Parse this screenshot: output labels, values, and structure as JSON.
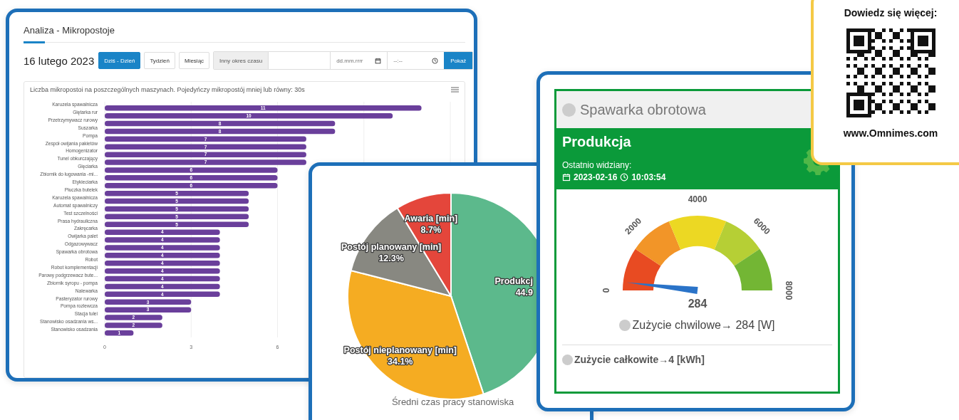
{
  "analysis_window": {
    "title": "Analiza - Mikropostoje",
    "date": "16 lutego 2023",
    "period_tabs": [
      {
        "label": "Dziś - Dzień",
        "selected": true
      },
      {
        "label": "Tydzień",
        "selected": false
      },
      {
        "label": "Miesiąc",
        "selected": false
      }
    ],
    "custom_range": {
      "label": "Inny okres czasu",
      "date_placeholder": "dd.mm.rrrr",
      "time_placeholder": "--:--",
      "button": "Pokaż"
    },
    "chart_data": {
      "type": "bar",
      "orientation": "horizontal",
      "title": "Liczba mikropostoi na poszczególnych maszynach. Pojedyńczy mikropostój mniej lub równy: 30s",
      "categories": [
        "Karuzela spawalnicza",
        "Giętarka rur",
        "Przetrzymywacz rurowy",
        "Suszarka",
        "Pompa",
        "Zespół owijania pakietów",
        "Homogenizator",
        "Tunel obkurczający",
        "Gięciarka",
        "Zbiornik do ługowania -mi...",
        "Etykieciarka",
        "Płuczka butelek",
        "Karuzela spawalnicza",
        "Automat spawalniczy",
        "Test szczelności",
        "Prasa hydrauliczna",
        "Zakręcarka",
        "Owijarka palet",
        "Odgazowywacz",
        "Spawarka obrotowa",
        "Robot",
        "Robot komplementacji",
        "Parowy podgrzewacz bute...",
        "Zbiornik syropu - pompa",
        "Nalewarka",
        "Pasteryzator rurowy",
        "Pompa rozlewcza",
        "Stacja tulei",
        "Stanowisko osadzania ws...",
        "Stanowisko osadzania"
      ],
      "values": [
        11,
        10,
        8,
        8,
        7,
        7,
        7,
        7,
        6,
        6,
        6,
        5,
        5,
        5,
        5,
        5,
        4,
        4,
        4,
        4,
        4,
        4,
        4,
        4,
        4,
        3,
        3,
        2,
        2,
        1
      ],
      "xticks": [
        0,
        3,
        6
      ],
      "xlim": [
        0,
        12
      ],
      "data_labels": true
    }
  },
  "pie_window": {
    "chart_data": {
      "type": "pie",
      "title": "Średni czas pracy stanowiska",
      "categories": [
        "Produkcj",
        "Postój nieplanowany [min]",
        "Postój planowany [min]",
        "Awaria [min]"
      ],
      "values": [
        44.9,
        34.1,
        12.3,
        8.7
      ],
      "value_labels": [
        "44.9",
        "34.1%",
        "12.3%",
        "8.7%"
      ]
    }
  },
  "machine_window": {
    "name": "Spawarka obrotowa",
    "status": "Produkcja",
    "last_seen_label": "Ostatnio widziany:",
    "last_seen_date": "2023-02-16",
    "last_seen_time": "10:03:54",
    "gauge": {
      "ticks": [
        "0",
        "2000",
        "4000",
        "6000",
        "8000"
      ],
      "value": "284"
    },
    "instant_usage": "Zużycie chwilowe→ 284 [W]",
    "total_usage": "Zużycie całkowite→4 [kWh]"
  },
  "promo": {
    "heading": "Dowiedz się więcej:",
    "url": "www.Omnimes.com"
  }
}
